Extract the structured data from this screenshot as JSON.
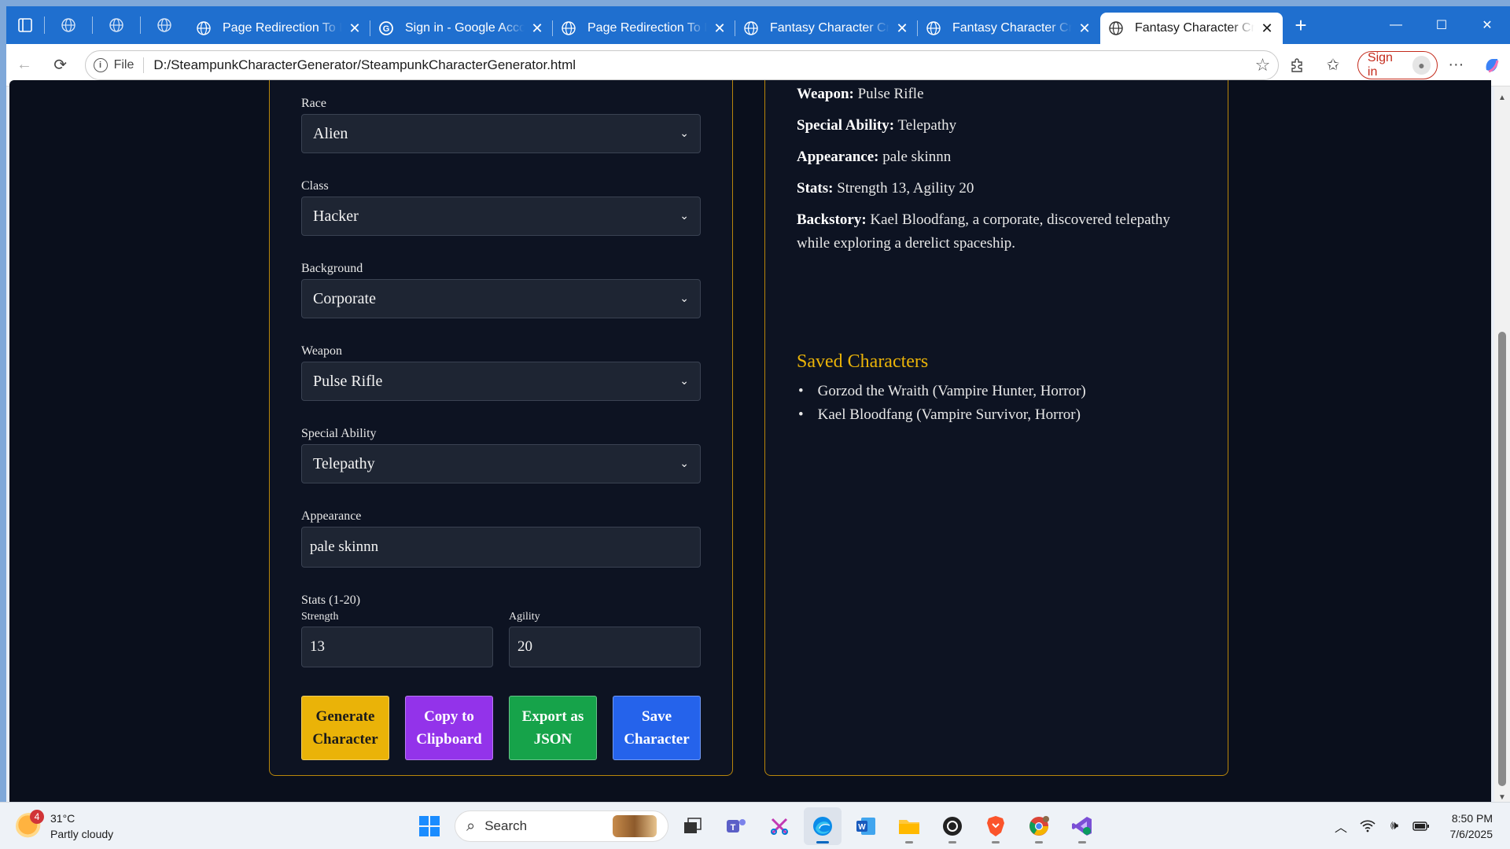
{
  "browser": {
    "tabs": [
      {
        "title": "Page Redirection To Log",
        "active": false
      },
      {
        "title": "Sign in - Google Accoun",
        "active": false
      },
      {
        "title": "Page Redirection To Log",
        "active": false
      },
      {
        "title": "Fantasy Character Creat",
        "active": false
      },
      {
        "title": "Fantasy Character Creat",
        "active": false
      },
      {
        "title": "Fantasy Character Creat",
        "active": true
      }
    ],
    "address": {
      "scheme_label": "File",
      "url": "D:/SteampunkCharacterGenerator/SteampunkCharacterGenerator.html"
    },
    "signin_label": "Sign in"
  },
  "form": {
    "race": {
      "label": "Race",
      "value": "Alien"
    },
    "class": {
      "label": "Class",
      "value": "Hacker"
    },
    "background": {
      "label": "Background",
      "value": "Corporate"
    },
    "weapon": {
      "label": "Weapon",
      "value": "Pulse Rifle"
    },
    "ability": {
      "label": "Special Ability",
      "value": "Telepathy"
    },
    "appearance": {
      "label": "Appearance",
      "value": "pale skinnn"
    },
    "stats": {
      "label": "Stats (1-20)",
      "strength": {
        "label": "Strength",
        "value": "13"
      },
      "agility": {
        "label": "Agility",
        "value": "20"
      }
    },
    "buttons": {
      "generate": "Generate Character",
      "copy": "Copy to Clipboard",
      "export": "Export as JSON",
      "save": "Save Character"
    }
  },
  "preview": {
    "weapon": {
      "label": "Weapon:",
      "value": "Pulse Rifle"
    },
    "ability": {
      "label": "Special Ability:",
      "value": "Telepathy"
    },
    "appearance": {
      "label": "Appearance:",
      "value": "pale skinnn"
    },
    "stats": {
      "label": "Stats:",
      "value": "Strength 13, Agility 20"
    },
    "backstory": {
      "label": "Backstory:",
      "value": "Kael Bloodfang, a corporate, discovered telepathy while exploring a derelict spaceship."
    },
    "saved_title": "Saved Characters",
    "saved": [
      "Gorzod the Wraith (Vampire Hunter, Horror)",
      "Kael Bloodfang (Vampire Survivor, Horror)"
    ]
  },
  "taskbar": {
    "weather_badge": "4",
    "temperature": "31°C",
    "condition": "Partly cloudy",
    "search_label": "Search",
    "time": "8:50 PM",
    "date": "7/6/2025"
  },
  "colors": {
    "accent_gold": "#eab308",
    "copy_purple": "#9333ea",
    "export_green": "#16a34a",
    "save_blue": "#2563eb",
    "page_bg": "#0a0f1c",
    "tabstrip_blue": "#1f6fcf"
  }
}
